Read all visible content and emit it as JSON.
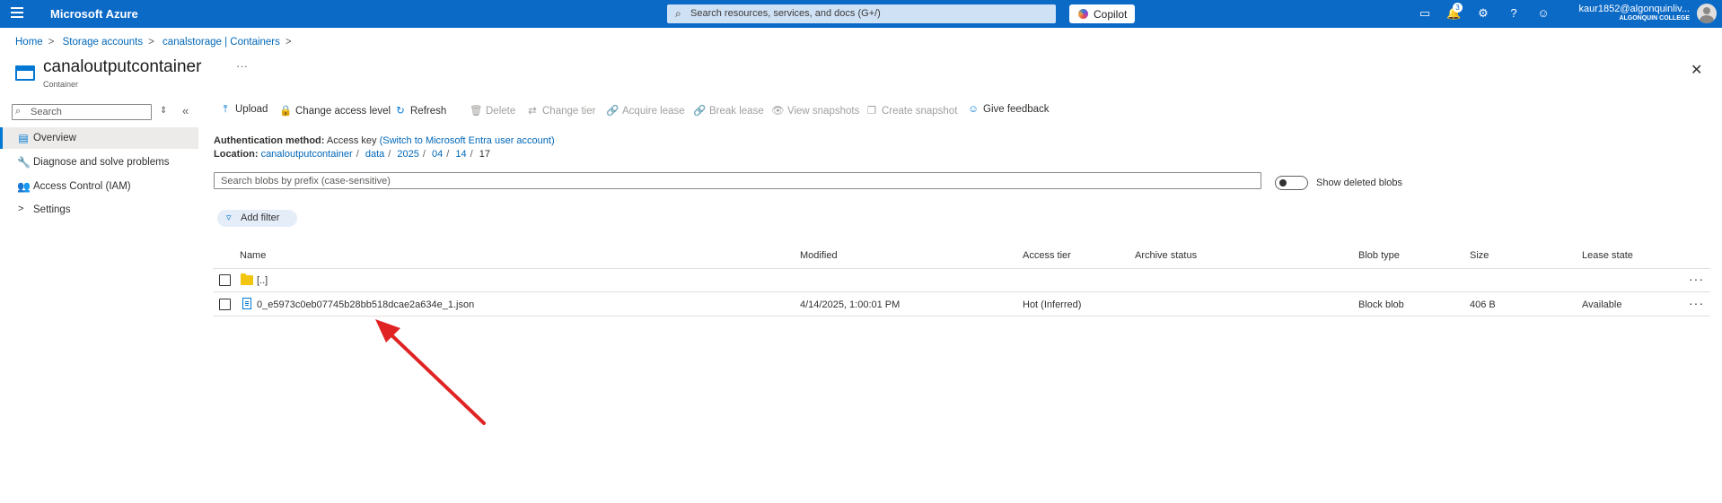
{
  "topbar": {
    "brand": "Microsoft Azure",
    "search_placeholder": "Search resources, services, and docs (G+/)",
    "copilot_label": "Copilot",
    "notification_count": "3",
    "account_name": "kaur1852@algonquinliv...",
    "account_org": "ALGONQUIN COLLEGE"
  },
  "breadcrumb": [
    "Home",
    "Storage accounts",
    "canalstorage | Containers"
  ],
  "page": {
    "title": "canaloutputcontainer",
    "subtitle": "Container",
    "more": "···"
  },
  "sidebar": {
    "search_placeholder": "Search",
    "items": [
      {
        "label": "Overview",
        "icon": "overview-icon"
      },
      {
        "label": "Diagnose and solve problems",
        "icon": "wrench-icon"
      },
      {
        "label": "Access Control (IAM)",
        "icon": "people-icon"
      },
      {
        "label": "Settings",
        "icon": "chevron-right-icon"
      }
    ]
  },
  "toolbar": {
    "upload": "Upload",
    "change_access": "Change access level",
    "refresh": "Refresh",
    "delete": "Delete",
    "change_tier": "Change tier",
    "acquire_lease": "Acquire lease",
    "break_lease": "Break lease",
    "view_snapshots": "View snapshots",
    "create_snapshot": "Create snapshot",
    "give_feedback": "Give feedback"
  },
  "info": {
    "auth_label": "Authentication method:",
    "auth_value": "Access key",
    "auth_link": "(Switch to Microsoft Entra user account)",
    "location_label": "Location:",
    "location_path": [
      "canaloutputcontainer",
      "data",
      "2025",
      "04",
      "14"
    ],
    "location_current": "17"
  },
  "blob_search_placeholder": "Search blobs by prefix (case-sensitive)",
  "show_deleted_label": "Show deleted blobs",
  "add_filter_label": "Add filter",
  "table": {
    "columns": [
      "Name",
      "Modified",
      "Access tier",
      "Archive status",
      "Blob type",
      "Size",
      "Lease state"
    ],
    "rows": [
      {
        "name": "[..]",
        "type": "folder",
        "modified": "",
        "tier": "",
        "archive": "",
        "blob_type": "",
        "size": "",
        "lease": ""
      },
      {
        "name": "0_e5973c0eb07745b28bb518dcae2a634e_1.json",
        "type": "file",
        "modified": "4/14/2025, 1:00:01 PM",
        "tier": "Hot (Inferred)",
        "archive": "",
        "blob_type": "Block blob",
        "size": "406 B",
        "lease": "Available"
      }
    ]
  },
  "colors": {
    "topbar": "#0c6ac7",
    "accent": "#0078d4",
    "annotation_arrow": "#e02424"
  }
}
